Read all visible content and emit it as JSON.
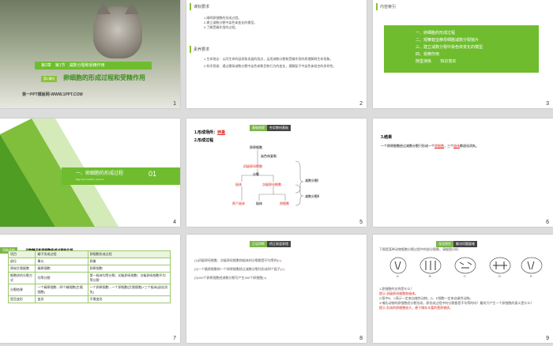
{
  "slides": [
    {
      "num": "1",
      "chapter": "第2章　第1节　减数分裂和受精作用",
      "lesson_badge": "第2课时",
      "title": "卵细胞的形成过程和受精作用",
      "footer": "第一PPT模板网-WWW.1PPT.COM"
    },
    {
      "num": "2",
      "section1": "课标要求",
      "req": [
        "1.阐明卵细胞的形成过程。",
        "2.建立减数分裂中染色体变化的模型。",
        "3.了解受精作用的过程。"
      ],
      "section2": "素养要求",
      "lit": [
        "1.生命观念：认同生命的延续和发展的观点，运用减数分裂和受精作用的原理解释生命现象。",
        "2.科学思维：通过模拟减数分裂中染色体数目和行为的变化，理解配子中染色体组合的多样性。"
      ]
    },
    {
      "num": "3",
      "tag": "内容索引",
      "items": [
        "一、卵细胞的形成过程",
        "二、观察蝗虫精母细胞减数分裂装片",
        "三、建立减数分裂中染色体变化的模型",
        "四、受精作用"
      ],
      "footer_items": [
        "随堂演练",
        "知识落实"
      ]
    },
    {
      "num": "4",
      "title": "一、卵细胞的形成过程",
      "subtitle": "Egg cell formation process",
      "index": "01"
    },
    {
      "num": "5",
      "header_a": "基础梳理",
      "header_b": "夯实教材基础",
      "site_label": "1.形成场所：",
      "site_value": "卵巢",
      "process_label": "2.形成过程",
      "diagram": {
        "oogonium": "卵原细胞",
        "dup": "染色体复制",
        "primary": "初级卵母细胞",
        "split": "分裂",
        "polar1": "极体",
        "secondary": "次级卵母细胞",
        "egg": "卵细胞",
        "polar2": "两个极体",
        "polar3": "极体",
        "mei1": "减数分裂Ⅰ",
        "mei2": "减数分裂Ⅱ"
      }
    },
    {
      "num": "6",
      "label": "3.结果",
      "text_a": "一个卵原细胞经过减数分裂只形成一个",
      "egg": "卵细胞",
      "text_b": "，三个",
      "polar": "极体",
      "text_c": "都退化消失。"
    },
    {
      "num": "7",
      "header": "归纳总结",
      "caption": "动物精子和卵细胞形成过程的比较",
      "table": [
        [
          "项目",
          "精子形成过程",
          "卵细胞形成过程"
        ],
        [
          "部位",
          "睾丸",
          "卵巢"
        ],
        [
          "原始生殖细胞",
          "精原细胞",
          "卵原细胞"
        ],
        [
          "细胞质的分裂方式",
          "均等分裂",
          "第一极体均等分裂，初级卵母细胞、次级卵母细胞不均等分裂"
        ],
        [
          "分裂结果",
          "一个精原细胞→四个精细胞(生殖细胞)",
          "一个卵原细胞→一个卵细胞(生殖细胞)+三个极体(退化消失)"
        ],
        [
          "是否变形",
          "变形",
          "不需变形"
        ]
      ]
    },
    {
      "num": "8",
      "header_a": "正误判断",
      "header_b": "矫正易混易错",
      "items": [
        {
          "text": "(1)初级卵母细胞、次级卵母细胞和极体的分裂都是不均等的(",
          "mark": "×",
          "end": ")"
        },
        {
          "text": "(2)一个精原细胞和一个卵原细胞经过减数分裂均形成四个配子(",
          "mark": "×",
          "end": ")"
        },
        {
          "text": "(3)100个卵原细胞经减数分裂可产生400个卵细胞(",
          "mark": "×",
          "end": ")"
        }
      ]
    },
    {
      "num": "9",
      "header_a": "深化探究",
      "header_b": "解决问题疑难",
      "intro": "下图是某种动物细胞分裂过程中的部分图像，请据图分析：",
      "cells": [
        "A",
        "B",
        "C",
        "D",
        "E"
      ],
      "q1": "1.卵细胞的名称是什么？",
      "a1_prefix": "提示",
      "a1": "初级卵母细胞和极体。",
      "q2": "2.图中B、C表示一定来自雄性动物，D、E细胞一定来自雌性动物。",
      "q3": "3.哺乳动物的卵细胞经分裂形成，卵形成过程中的分裂都是不均等的吗？最终只产生一个卵细胞的意义是什么？",
      "a3_prefix": "提示",
      "a3": "形成的卵细胞较大，便于储存丰富的营养物质。"
    }
  ]
}
